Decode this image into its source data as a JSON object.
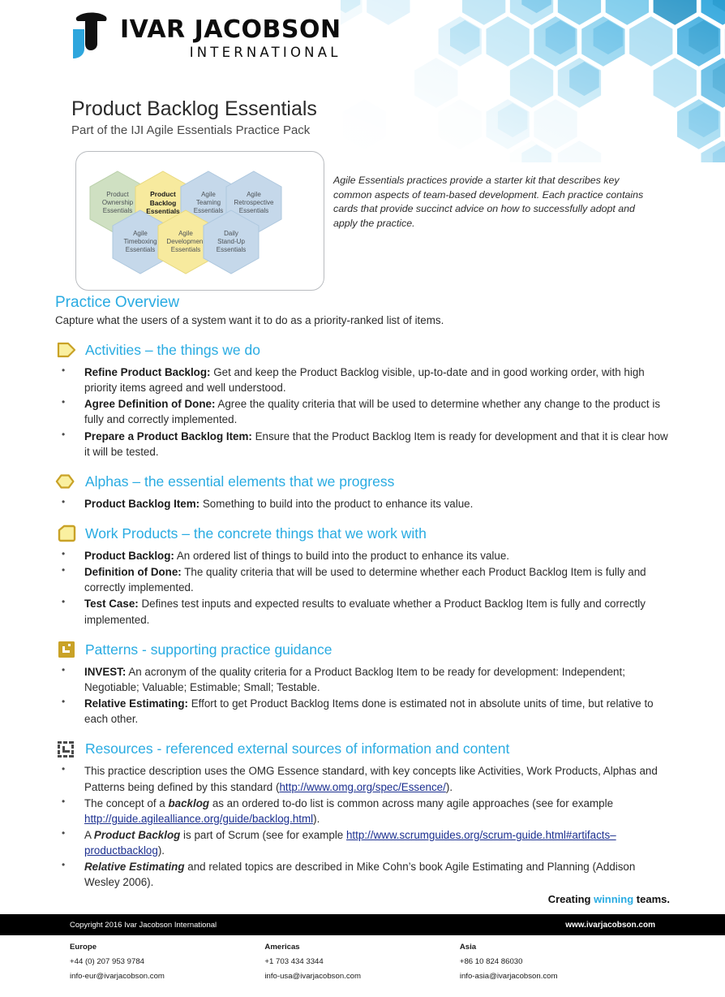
{
  "brand": {
    "logo_name": "IVAR JACOBSON",
    "logo_sub": "INTERNATIONAL",
    "accent_blue": "#29abe2",
    "logo_black": "#0d0d0d",
    "link_blue": "#1b2f8f",
    "icon_gold": "#c9a227",
    "icon_yellow": "#faf0a0"
  },
  "title": {
    "main": "Product Backlog Essentials",
    "subtitle": "Part of the IJI Agile Essentials Practice Pack"
  },
  "practice_pack": {
    "note": "Agile Essentials practices provide a starter kit that describes key common aspects of team-based development. Each practice contains cards that provide succinct advice on how to successfully adopt and apply the practice.",
    "hexagons": [
      {
        "label": "Product\nOwnership\nEssentials",
        "color": "#cfe0c2",
        "stroke": "#b9cfa9",
        "active": false
      },
      {
        "label": "Product\nBacklog\nEssentials",
        "color": "#f7ea9e",
        "stroke": "#e7d87e",
        "active": true
      },
      {
        "label": "Agile\nTeaming\nEssentials",
        "color": "#c5d8ea",
        "stroke": "#adc7de",
        "active": false
      },
      {
        "label": "Agile\nRetrospective\nEssentials",
        "color": "#c5d8ea",
        "stroke": "#adc7de",
        "active": false
      },
      {
        "label": "Agile\nTimeboxing\nEssentials",
        "color": "#c5d8ea",
        "stroke": "#adc7de",
        "active": false
      },
      {
        "label": "Agile\nDevelopment\nEssentials",
        "color": "#f7ea9e",
        "stroke": "#e7d87e",
        "active": false
      },
      {
        "label": "Daily\nStand-Up\nEssentials",
        "color": "#c5d8ea",
        "stroke": "#adc7de",
        "active": false
      }
    ]
  },
  "overview": {
    "heading": "Practice Overview",
    "text": "Capture what the users of a system want it to do as a priority-ranked list of items."
  },
  "sections": [
    {
      "id": "activities",
      "icon": "activity-pentagon-icon",
      "heading": "Activities – the things we do",
      "items": [
        {
          "term": "Refine Product Backlog:",
          "desc": " Get and keep the Product Backlog visible, up-to-date and in good working order, with high priority items agreed and well understood."
        },
        {
          "term": "Agree Definition of Done:",
          "desc": " Agree the quality criteria that will be used to determine whether any change to the product is fully and correctly implemented."
        },
        {
          "term": "Prepare a Product Backlog Item:",
          "desc": " Ensure that the Product Backlog Item is ready for development and that it is clear how it will be tested."
        }
      ]
    },
    {
      "id": "alphas",
      "icon": "alpha-capsule-icon",
      "heading": "Alphas – the essential elements that we progress",
      "items": [
        {
          "term": "Product Backlog Item:",
          "desc": " Something to build into the product to enhance its value."
        }
      ]
    },
    {
      "id": "work-products",
      "icon": "work-product-document-icon",
      "heading": "Work Products – the concrete things that we work with",
      "items": [
        {
          "term": "Product Backlog:",
          "desc": " An ordered list of things to build into the product to enhance its value."
        },
        {
          "term": "Definition of Done:",
          "desc": " The quality criteria that will be used to determine whether each Product Backlog Item is fully and correctly implemented."
        },
        {
          "term": "Test Case:",
          "desc": " Defines test inputs and expected results to evaluate whether a Product Backlog Item is fully and correctly implemented."
        }
      ]
    },
    {
      "id": "patterns",
      "icon": "pattern-square-icon",
      "heading": "Patterns - supporting practice guidance",
      "items": [
        {
          "term": "INVEST:",
          "desc": " An acronym of the quality criteria for a Product Backlog Item to be ready for development: Independent; Negotiable; Valuable; Estimable; Small; Testable."
        },
        {
          "term": "Relative Estimating:",
          "desc": " Effort to get Product Backlog Items done is estimated not in absolute units of time, but relative to each other."
        }
      ]
    }
  ],
  "resources": {
    "icon": "resources-dashed-square-icon",
    "heading": "Resources - referenced external sources of information and content",
    "items": [
      {
        "parts": [
          {
            "t": "text",
            "v": "This practice description uses the OMG Essence standard, with key concepts like Activities, Work Products, Alphas and Patterns being defined by this standard ("
          },
          {
            "t": "link",
            "v": "http://www.omg.org/spec/Essence/"
          },
          {
            "t": "text",
            "v": ")."
          }
        ]
      },
      {
        "parts": [
          {
            "t": "text",
            "v": "The concept of a "
          },
          {
            "t": "em",
            "v": "backlog"
          },
          {
            "t": "text",
            "v": " as an ordered to-do list is common across many agile approaches (see for example "
          },
          {
            "t": "link",
            "v": "http://guide.agilealliance.org/guide/backlog.html"
          },
          {
            "t": "text",
            "v": ")."
          }
        ]
      },
      {
        "parts": [
          {
            "t": "text",
            "v": "A "
          },
          {
            "t": "em",
            "v": "Product Backlog"
          },
          {
            "t": "text",
            "v": " is part of Scrum (see for example "
          },
          {
            "t": "link",
            "v": "http://www.scrumguides.org/scrum-guide.html#artifacts–productbacklog"
          },
          {
            "t": "text",
            "v": ")."
          }
        ]
      },
      {
        "parts": [
          {
            "t": "em",
            "v": "Relative Estimating"
          },
          {
            "t": "text",
            "v": " and related topics are described in Mike Cohn’s book Agile Estimating and Planning (Addison Wesley 2006)."
          }
        ]
      }
    ]
  },
  "tagline": {
    "pre": "Creating ",
    "accent": "winning",
    "post": " teams."
  },
  "footer": {
    "copyright": "Copyright 2016 Ivar Jacobson International",
    "website": "www.ivarjacobson.com",
    "contacts": [
      {
        "region": "Europe",
        "phone": "+44 (0) 207 953 9784",
        "email": "info-eur@ivarjacobson.com"
      },
      {
        "region": "Americas",
        "phone": "+1 703 434 3344",
        "email": "info-usa@ivarjacobson.com"
      },
      {
        "region": "Asia",
        "phone": "+86 10 824 86030",
        "email": "info-asia@ivarjacobson.com"
      }
    ]
  }
}
